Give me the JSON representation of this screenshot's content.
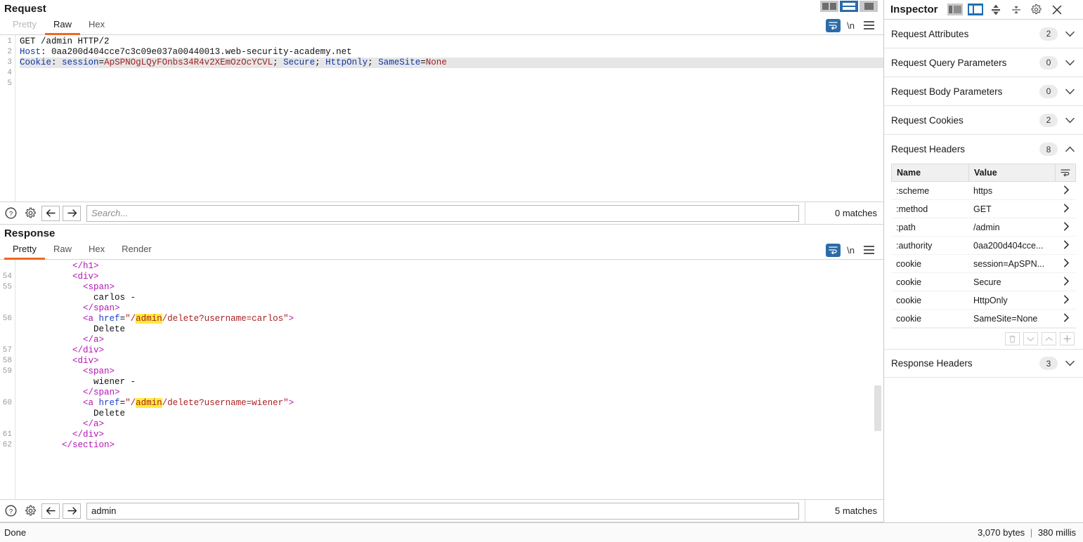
{
  "request_panel": {
    "title": "Request",
    "tabs": [
      {
        "label": "Pretty",
        "state": "dim"
      },
      {
        "label": "Raw",
        "state": "active"
      },
      {
        "label": "Hex",
        "state": "normal"
      }
    ],
    "layout_buttons": [
      "split-vertical-icon",
      "split-horizontal-icon",
      "single-pane-icon"
    ],
    "layout_selected_index": 1,
    "editor_icons": [
      "word-wrap-icon",
      "show-newlines-icon",
      "editor-menu-icon"
    ],
    "newline_label": "\\n",
    "line_numbers": [
      "1",
      "2",
      "3",
      "4",
      "5"
    ],
    "lines": [
      {
        "n": "1",
        "highlight": false,
        "parts": [
          {
            "t": "GET /admin HTTP/2",
            "c": "plain"
          }
        ]
      },
      {
        "n": "2",
        "highlight": false,
        "parts": [
          {
            "t": "Host",
            "c": "blue"
          },
          {
            "t": ": ",
            "c": "plain"
          },
          {
            "t": "0aa200d404cce7c3c09e037a00440013.web-security-academy.net",
            "c": "plain"
          }
        ]
      },
      {
        "n": "3",
        "highlight": true,
        "parts": [
          {
            "t": "Cookie",
            "c": "blue"
          },
          {
            "t": ": ",
            "c": "plain"
          },
          {
            "t": "session",
            "c": "blue"
          },
          {
            "t": "=",
            "c": "plain"
          },
          {
            "t": "ApSPNOgLQyFOnbs34R4v2XEmOzOcYCVL",
            "c": "red"
          },
          {
            "t": "; ",
            "c": "plain"
          },
          {
            "t": "Secure",
            "c": "blue"
          },
          {
            "t": "; ",
            "c": "plain"
          },
          {
            "t": "HttpOnly",
            "c": "blue"
          },
          {
            "t": "; ",
            "c": "plain"
          },
          {
            "t": "SameSite",
            "c": "blue"
          },
          {
            "t": "=",
            "c": "plain"
          },
          {
            "t": "None",
            "c": "red"
          }
        ]
      },
      {
        "n": "4",
        "highlight": false,
        "parts": []
      },
      {
        "n": "5",
        "highlight": false,
        "parts": []
      }
    ],
    "search": {
      "help_icon": "help-icon",
      "settings_icon": "gear-icon",
      "prev_icon": "arrow-left-icon",
      "next_icon": "arrow-right-icon",
      "value": "",
      "placeholder": "Search...",
      "matches": "0 matches"
    }
  },
  "response_panel": {
    "title": "Response",
    "tabs": [
      {
        "label": "Pretty",
        "state": "active"
      },
      {
        "label": "Raw",
        "state": "normal"
      },
      {
        "label": "Hex",
        "state": "normal"
      },
      {
        "label": "Render",
        "state": "normal"
      }
    ],
    "editor_icons": [
      "word-wrap-icon",
      "show-newlines-icon",
      "editor-menu-icon"
    ],
    "newline_label": "\\n",
    "lines": [
      {
        "n": "",
        "indent": 5,
        "parts": [
          {
            "t": "</",
            "c": "tag"
          },
          {
            "t": "h1",
            "c": "tag"
          },
          {
            "t": ">",
            "c": "tag"
          }
        ]
      },
      {
        "n": "54",
        "indent": 5,
        "parts": [
          {
            "t": "<",
            "c": "tag"
          },
          {
            "t": "div",
            "c": "tag"
          },
          {
            "t": ">",
            "c": "tag"
          }
        ]
      },
      {
        "n": "55",
        "indent": 6,
        "parts": [
          {
            "t": "<",
            "c": "tag"
          },
          {
            "t": "span",
            "c": "tag"
          },
          {
            "t": ">",
            "c": "tag"
          }
        ]
      },
      {
        "n": "",
        "indent": 7,
        "parts": [
          {
            "t": "carlos -",
            "c": "plain"
          }
        ]
      },
      {
        "n": "",
        "indent": 6,
        "parts": [
          {
            "t": "</",
            "c": "tag"
          },
          {
            "t": "span",
            "c": "tag"
          },
          {
            "t": ">",
            "c": "tag"
          }
        ]
      },
      {
        "n": "56",
        "indent": 6,
        "parts": [
          {
            "t": "<",
            "c": "tag"
          },
          {
            "t": "a ",
            "c": "tag"
          },
          {
            "t": "href",
            "c": "attr"
          },
          {
            "t": "=",
            "c": "plain"
          },
          {
            "t": "\"/",
            "c": "val"
          },
          {
            "t": "admin",
            "c": "val mark"
          },
          {
            "t": "/delete?username=carlos\"",
            "c": "val"
          },
          {
            "t": ">",
            "c": "tag"
          }
        ]
      },
      {
        "n": "",
        "indent": 7,
        "parts": [
          {
            "t": "Delete",
            "c": "plain"
          }
        ]
      },
      {
        "n": "",
        "indent": 6,
        "parts": [
          {
            "t": "</",
            "c": "tag"
          },
          {
            "t": "a",
            "c": "tag"
          },
          {
            "t": ">",
            "c": "tag"
          }
        ]
      },
      {
        "n": "57",
        "indent": 5,
        "parts": [
          {
            "t": "</",
            "c": "tag"
          },
          {
            "t": "div",
            "c": "tag"
          },
          {
            "t": ">",
            "c": "tag"
          }
        ]
      },
      {
        "n": "58",
        "indent": 5,
        "parts": [
          {
            "t": "<",
            "c": "tag"
          },
          {
            "t": "div",
            "c": "tag"
          },
          {
            "t": ">",
            "c": "tag"
          }
        ]
      },
      {
        "n": "59",
        "indent": 6,
        "parts": [
          {
            "t": "<",
            "c": "tag"
          },
          {
            "t": "span",
            "c": "tag"
          },
          {
            "t": ">",
            "c": "tag"
          }
        ]
      },
      {
        "n": "",
        "indent": 7,
        "parts": [
          {
            "t": "wiener -",
            "c": "plain"
          }
        ]
      },
      {
        "n": "",
        "indent": 6,
        "parts": [
          {
            "t": "</",
            "c": "tag"
          },
          {
            "t": "span",
            "c": "tag"
          },
          {
            "t": ">",
            "c": "tag"
          }
        ]
      },
      {
        "n": "60",
        "indent": 6,
        "parts": [
          {
            "t": "<",
            "c": "tag"
          },
          {
            "t": "a ",
            "c": "tag"
          },
          {
            "t": "href",
            "c": "attr"
          },
          {
            "t": "=",
            "c": "plain"
          },
          {
            "t": "\"/",
            "c": "val"
          },
          {
            "t": "admin",
            "c": "val mark"
          },
          {
            "t": "/delete?username=wiener\"",
            "c": "val"
          },
          {
            "t": ">",
            "c": "tag"
          }
        ]
      },
      {
        "n": "",
        "indent": 7,
        "parts": [
          {
            "t": "Delete",
            "c": "plain"
          }
        ]
      },
      {
        "n": "",
        "indent": 6,
        "parts": [
          {
            "t": "</",
            "c": "tag"
          },
          {
            "t": "a",
            "c": "tag"
          },
          {
            "t": ">",
            "c": "tag"
          }
        ]
      },
      {
        "n": "61",
        "indent": 5,
        "parts": [
          {
            "t": "</",
            "c": "tag"
          },
          {
            "t": "div",
            "c": "tag"
          },
          {
            "t": ">",
            "c": "tag"
          }
        ]
      },
      {
        "n": "62",
        "indent": 4,
        "parts": [
          {
            "t": "</",
            "c": "tag"
          },
          {
            "t": "section",
            "c": "tag"
          },
          {
            "t": ">",
            "c": "tag"
          }
        ]
      }
    ],
    "search": {
      "help_icon": "help-icon",
      "settings_icon": "gear-icon",
      "prev_icon": "arrow-left-icon",
      "next_icon": "arrow-right-icon",
      "value": "admin",
      "placeholder": "Search...",
      "matches": "5 matches"
    }
  },
  "inspector": {
    "title": "Inspector",
    "header_icons": [
      "panel-left-icon",
      "panel-right-icon",
      "expand-all-icon",
      "collapse-all-icon",
      "gear-icon",
      "close-icon"
    ],
    "sections": [
      {
        "label": "Request Attributes",
        "count": "2",
        "expanded": false
      },
      {
        "label": "Request Query Parameters",
        "count": "0",
        "expanded": false
      },
      {
        "label": "Request Body Parameters",
        "count": "0",
        "expanded": false
      },
      {
        "label": "Request Cookies",
        "count": "2",
        "expanded": false
      },
      {
        "label": "Request Headers",
        "count": "8",
        "expanded": true
      }
    ],
    "headers_table": {
      "columns": [
        "Name",
        "Value"
      ],
      "sort_icon": "column-options-icon",
      "rows": [
        {
          "name": ":scheme",
          "value": "https"
        },
        {
          "name": ":method",
          "value": "GET"
        },
        {
          "name": ":path",
          "value": "/admin"
        },
        {
          "name": ":authority",
          "value": "0aa200d404cce..."
        },
        {
          "name": "cookie",
          "value": "session=ApSPN..."
        },
        {
          "name": "cookie",
          "value": "Secure"
        },
        {
          "name": "cookie",
          "value": "HttpOnly"
        },
        {
          "name": "cookie",
          "value": "SameSite=None"
        }
      ],
      "row_chevron": "chevron-right-icon",
      "actions": [
        "delete-icon",
        "move-down-icon",
        "move-up-icon",
        "add-icon"
      ]
    },
    "response_headers": {
      "label": "Response Headers",
      "count": "3",
      "expanded": false
    }
  },
  "statusbar": {
    "left": "Done",
    "size": "3,070 bytes",
    "separator": "|",
    "time": "380 millis"
  },
  "colors": {
    "accent_orange": "#ef6721",
    "accent_blue": "#2c6ba8",
    "highlight_yellow": "#ffeb3b",
    "tag_purple": "#b313b3",
    "attr_blue": "#1c3fcf",
    "value_red": "#a82121"
  }
}
